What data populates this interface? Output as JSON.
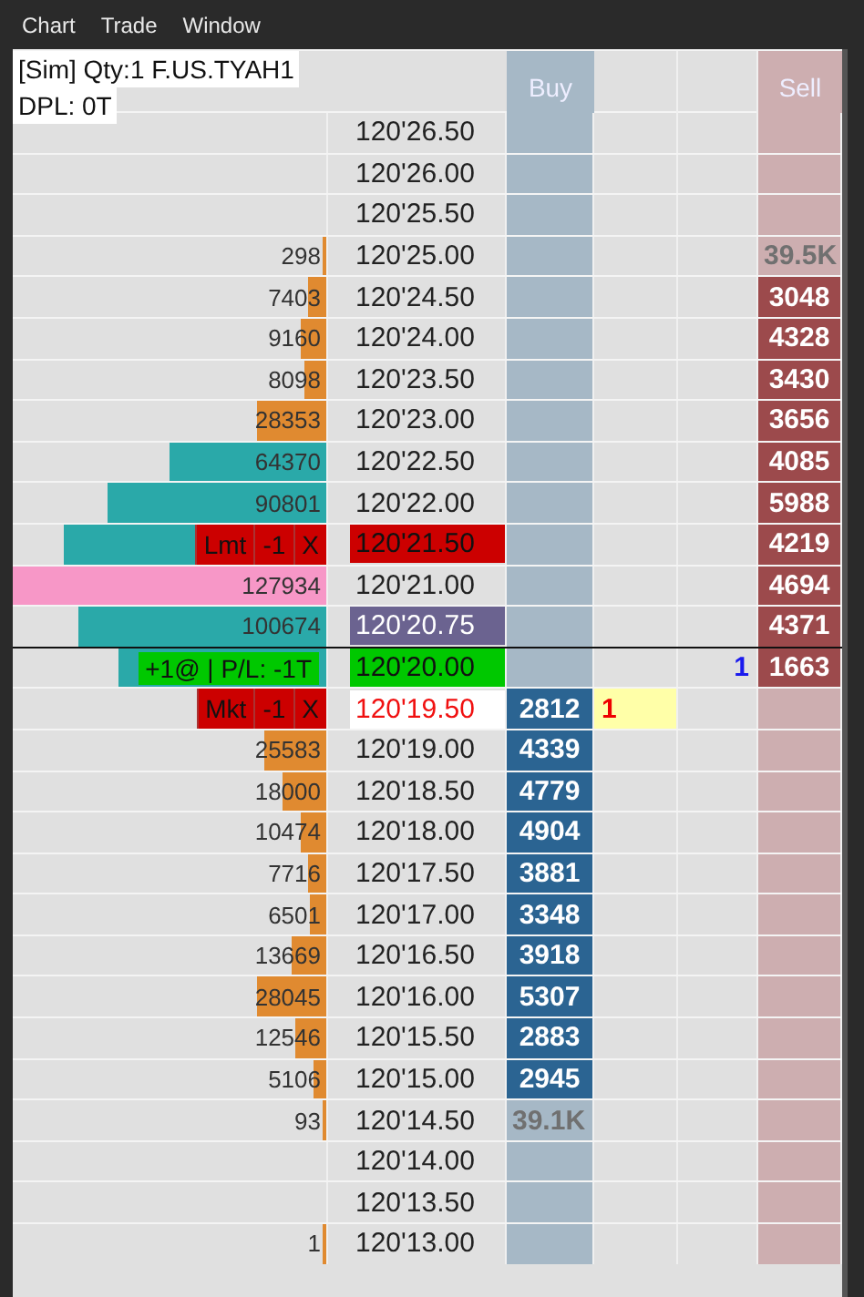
{
  "menu": [
    "Chart",
    "Trade",
    "Window"
  ],
  "info": {
    "line_1": "[Sim]  Qty:1 F.US.TYAH1",
    "line_2": "DPL: 0T"
  },
  "columns": {
    "buy": "Buy",
    "sell": "Sell"
  },
  "rows": [
    {
      "price": "120'26.50",
      "kind": "plain"
    },
    {
      "price": "120'26.00",
      "kind": "plain"
    },
    {
      "price": "120'25.50",
      "kind": "plain"
    },
    {
      "volume": "298",
      "level": 0.01,
      "color": "#e08a30",
      "price": "120'25.00",
      "kind": "plain",
      "sell": {
        "text": "39.5K",
        "kind": "total"
      }
    },
    {
      "volume": "7403",
      "level": 0.06,
      "color": "#e08a30",
      "price": "120'24.50",
      "kind": "plain",
      "sell": {
        "text": "3048",
        "kind": "size"
      }
    },
    {
      "volume": "9160",
      "level": 0.08,
      "color": "#e08a30",
      "price": "120'24.00",
      "kind": "plain",
      "sell": {
        "text": "4328",
        "kind": "size"
      }
    },
    {
      "volume": "8098",
      "level": 0.07,
      "color": "#e08a30",
      "price": "120'23.50",
      "kind": "plain",
      "sell": {
        "text": "3430",
        "kind": "size"
      }
    },
    {
      "volume": "28353",
      "level": 0.22,
      "color": "#e08a30",
      "price": "120'23.00",
      "kind": "plain",
      "sell": {
        "text": "3656",
        "kind": "size"
      }
    },
    {
      "volume": "64370",
      "level": 0.5,
      "color": "#2aa9a9",
      "price": "120'22.50",
      "kind": "plain",
      "sell": {
        "text": "4085",
        "kind": "size"
      }
    },
    {
      "volume": "90801",
      "level": 0.7,
      "color": "#2aa9a9",
      "price": "120'22.00",
      "kind": "plain",
      "sell": {
        "text": "5988",
        "kind": "size"
      }
    },
    {
      "level": 0.84,
      "color": "#2aa9a9",
      "order": {
        "type": "Lmt",
        "qty": "-1",
        "cancel": "X"
      },
      "price": "120'21.50",
      "kind": "order",
      "sell": {
        "text": "4219",
        "kind": "size"
      }
    },
    {
      "volume": "127934",
      "level": 1,
      "color": "#f797c7",
      "price": "120'21.00",
      "kind": "plain",
      "sell": {
        "text": "4694",
        "kind": "size"
      }
    },
    {
      "volume": "100674",
      "level": 0.79,
      "color": "#2aa9a9",
      "price": "120'20.75",
      "kind": "last",
      "sell": {
        "text": "4371",
        "kind": "size"
      }
    },
    {
      "level": 0.66,
      "color": "#2aa9a9",
      "position": "+1@ | P/L: -1T",
      "price": "120'20.00",
      "kind": "position",
      "column_5": "1",
      "sell": {
        "text": "1663",
        "kind": "size"
      }
    },
    {
      "order": {
        "type": "Mkt",
        "qty": "-1",
        "cancel": "X"
      },
      "price": "120'19.50",
      "kind": "market",
      "buy": {
        "text": "2812",
        "kind": "size"
      },
      "column_4": "1"
    },
    {
      "volume": "25583",
      "level": 0.2,
      "color": "#e08a30",
      "price": "120'19.00",
      "kind": "plain",
      "buy": {
        "text": "4339",
        "kind": "size"
      }
    },
    {
      "volume": "18000",
      "level": 0.14,
      "color": "#e08a30",
      "price": "120'18.50",
      "kind": "plain",
      "buy": {
        "text": "4779",
        "kind": "size"
      }
    },
    {
      "volume": "10474",
      "level": 0.08,
      "color": "#e08a30",
      "price": "120'18.00",
      "kind": "plain",
      "buy": {
        "text": "4904",
        "kind": "size"
      }
    },
    {
      "volume": "7716",
      "level": 0.06,
      "color": "#e08a30",
      "price": "120'17.50",
      "kind": "plain",
      "buy": {
        "text": "3881",
        "kind": "size"
      }
    },
    {
      "volume": "6501",
      "level": 0.05,
      "color": "#e08a30",
      "price": "120'17.00",
      "kind": "plain",
      "buy": {
        "text": "3348",
        "kind": "size"
      }
    },
    {
      "volume": "13669",
      "level": 0.11,
      "color": "#e08a30",
      "price": "120'16.50",
      "kind": "plain",
      "buy": {
        "text": "3918",
        "kind": "size"
      }
    },
    {
      "volume": "28045",
      "level": 0.22,
      "color": "#e08a30",
      "price": "120'16.00",
      "kind": "plain",
      "buy": {
        "text": "5307",
        "kind": "size"
      }
    },
    {
      "volume": "12546",
      "level": 0.1,
      "color": "#e08a30",
      "price": "120'15.50",
      "kind": "plain",
      "buy": {
        "text": "2883",
        "kind": "size"
      }
    },
    {
      "volume": "5106",
      "level": 0.04,
      "color": "#e08a30",
      "price": "120'15.00",
      "kind": "plain",
      "buy": {
        "text": "2945",
        "kind": "size"
      }
    },
    {
      "volume": "93",
      "level": 0.01,
      "color": "#e08a30",
      "price": "120'14.50",
      "kind": "plain",
      "buy": {
        "text": "39.1K",
        "kind": "total"
      }
    },
    {
      "price": "120'14.00",
      "kind": "plain"
    },
    {
      "price": "120'13.50",
      "kind": "plain"
    },
    {
      "volume": "1",
      "level": 0.01,
      "color": "#e08a30",
      "price": "120'13.00",
      "kind": "plain"
    }
  ]
}
